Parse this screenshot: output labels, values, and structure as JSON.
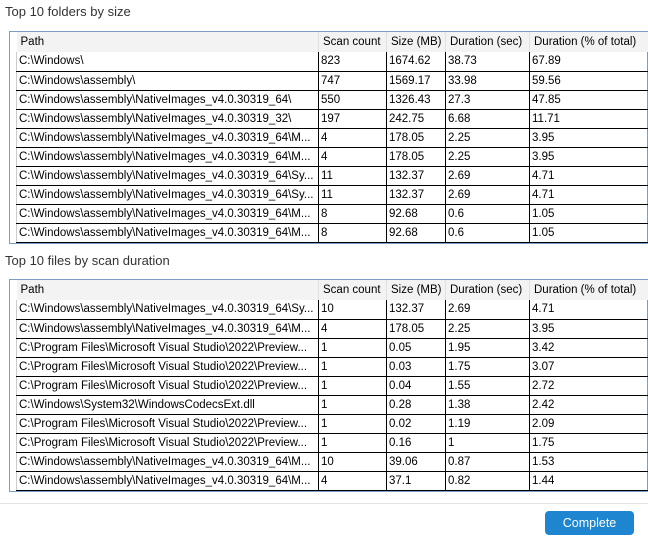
{
  "columns": [
    "Path",
    "Scan count",
    "Size (MB)",
    "Duration (sec)",
    "Duration (% of total)"
  ],
  "folders": {
    "title": "Top 10 folders by size",
    "rows": [
      [
        "C:\\Windows\\",
        "823",
        "1674.62",
        "38.73",
        "67.89"
      ],
      [
        "C:\\Windows\\assembly\\",
        "747",
        "1569.17",
        "33.98",
        "59.56"
      ],
      [
        "C:\\Windows\\assembly\\NativeImages_v4.0.30319_64\\",
        "550",
        "1326.43",
        "27.3",
        "47.85"
      ],
      [
        "C:\\Windows\\assembly\\NativeImages_v4.0.30319_32\\",
        "197",
        "242.75",
        "6.68",
        "11.71"
      ],
      [
        "C:\\Windows\\assembly\\NativeImages_v4.0.30319_64\\M...",
        "4",
        "178.05",
        "2.25",
        "3.95"
      ],
      [
        "C:\\Windows\\assembly\\NativeImages_v4.0.30319_64\\M...",
        "4",
        "178.05",
        "2.25",
        "3.95"
      ],
      [
        "C:\\Windows\\assembly\\NativeImages_v4.0.30319_64\\Sy...",
        "11",
        "132.37",
        "2.69",
        "4.71"
      ],
      [
        "C:\\Windows\\assembly\\NativeImages_v4.0.30319_64\\Sy...",
        "11",
        "132.37",
        "2.69",
        "4.71"
      ],
      [
        "C:\\Windows\\assembly\\NativeImages_v4.0.30319_64\\M...",
        "8",
        "92.68",
        "0.6",
        "1.05"
      ],
      [
        "C:\\Windows\\assembly\\NativeImages_v4.0.30319_64\\M...",
        "8",
        "92.68",
        "0.6",
        "1.05"
      ]
    ]
  },
  "files": {
    "title": "Top 10 files by scan duration",
    "rows": [
      [
        "C:\\Windows\\assembly\\NativeImages_v4.0.30319_64\\Sy...",
        "10",
        "132.37",
        "2.69",
        "4.71"
      ],
      [
        "C:\\Windows\\assembly\\NativeImages_v4.0.30319_64\\M...",
        "4",
        "178.05",
        "2.25",
        "3.95"
      ],
      [
        "C:\\Program Files\\Microsoft Visual Studio\\2022\\Preview...",
        "1",
        "0.05",
        "1.95",
        "3.42"
      ],
      [
        "C:\\Program Files\\Microsoft Visual Studio\\2022\\Preview...",
        "1",
        "0.03",
        "1.75",
        "3.07"
      ],
      [
        "C:\\Program Files\\Microsoft Visual Studio\\2022\\Preview...",
        "1",
        "0.04",
        "1.55",
        "2.72"
      ],
      [
        "C:\\Windows\\System32\\WindowsCodecsExt.dll",
        "1",
        "0.28",
        "1.38",
        "2.42"
      ],
      [
        "C:\\Program Files\\Microsoft Visual Studio\\2022\\Preview...",
        "1",
        "0.02",
        "1.19",
        "2.09"
      ],
      [
        "C:\\Program Files\\Microsoft Visual Studio\\2022\\Preview...",
        "1",
        "0.16",
        "1",
        "1.75"
      ],
      [
        "C:\\Windows\\assembly\\NativeImages_v4.0.30319_64\\M...",
        "10",
        "39.06",
        "0.87",
        "1.53"
      ],
      [
        "C:\\Windows\\assembly\\NativeImages_v4.0.30319_64\\M...",
        "4",
        "37.1",
        "0.82",
        "1.44"
      ]
    ]
  },
  "complete_label": "Complete",
  "accent": "#1e86d0"
}
